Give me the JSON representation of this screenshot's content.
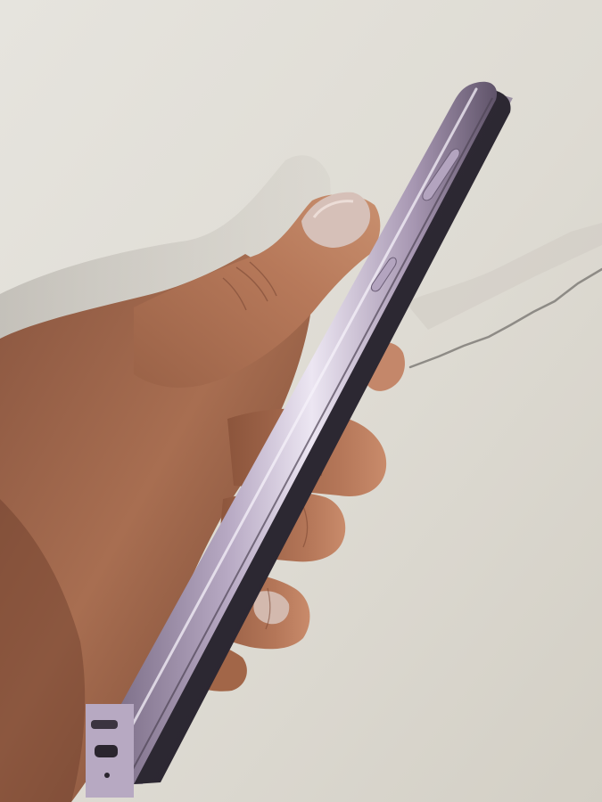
{
  "scene": {
    "subject": "smartphone-side-profile-held-in-hand",
    "colors": {
      "wall_top": "#e3e1db",
      "wall_bottom": "#ddd9d0",
      "crack": "#8e8b86",
      "shadow": "#bdb9b2",
      "skin_dark": "#7a4a34",
      "skin_mid": "#a36a4d",
      "skin_light": "#c48a6b",
      "skin_highlight": "#d9a487",
      "nail": "#d9c6c0",
      "frame_lavender": "#a99ab3",
      "frame_highlight": "#e7e0ee",
      "frame_dark": "#5a4f63",
      "screen_glass": "#2a2630",
      "back_glass": "#8f829a"
    }
  }
}
